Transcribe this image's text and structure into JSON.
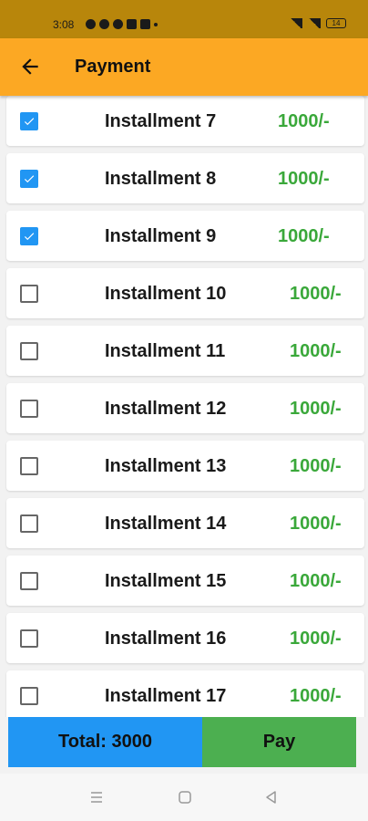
{
  "status_bar": {
    "time": "3:08",
    "battery": "14"
  },
  "app_bar": {
    "title": "Payment",
    "back_icon": "arrow-left-icon"
  },
  "installments": [
    {
      "label": "Installment 7",
      "amount": "1000/-",
      "checked": true
    },
    {
      "label": "Installment 8",
      "amount": "1000/-",
      "checked": true
    },
    {
      "label": "Installment 9",
      "amount": "1000/-",
      "checked": true
    },
    {
      "label": "Installment 10",
      "amount": "1000/-",
      "checked": false
    },
    {
      "label": "Installment 11",
      "amount": "1000/-",
      "checked": false
    },
    {
      "label": "Installment 12",
      "amount": "1000/-",
      "checked": false
    },
    {
      "label": "Installment 13",
      "amount": "1000/-",
      "checked": false
    },
    {
      "label": "Installment 14",
      "amount": "1000/-",
      "checked": false
    },
    {
      "label": "Installment 15",
      "amount": "1000/-",
      "checked": false
    },
    {
      "label": "Installment 16",
      "amount": "1000/-",
      "checked": false
    },
    {
      "label": "Installment 17",
      "amount": "1000/-",
      "checked": false
    }
  ],
  "footer": {
    "total_label": "Total: 3000",
    "pay_label": "Pay"
  },
  "colors": {
    "app_bar": "#fca823",
    "checkbox": "#2196f3",
    "amount": "#3aa83a",
    "total_bg": "#2196f3",
    "pay_bg": "#4caf50"
  }
}
